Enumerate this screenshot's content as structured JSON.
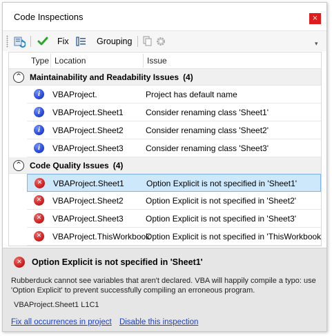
{
  "window": {
    "title": "Code Inspections",
    "close_glyph": "×"
  },
  "toolbar": {
    "fix_label": "Fix",
    "grouping_label": "Grouping",
    "overflow_glyph": "▾"
  },
  "grid": {
    "columns": [
      "Type",
      "Location",
      "Issue"
    ],
    "groups": [
      {
        "title": "Maintainability and Readability Issues",
        "count": "(4)",
        "toggle_glyph": "^",
        "rows": [
          {
            "icon": "info-icon",
            "location": "VBAProject.",
            "issue": "Project has default name"
          },
          {
            "icon": "info-icon",
            "location": "VBAProject.Sheet1",
            "issue": "Consider renaming class 'Sheet1'"
          },
          {
            "icon": "info-icon",
            "location": "VBAProject.Sheet2",
            "issue": "Consider renaming class 'Sheet2'"
          },
          {
            "icon": "info-icon",
            "location": "VBAProject.Sheet3",
            "issue": "Consider renaming class 'Sheet3'"
          }
        ]
      },
      {
        "title": "Code Quality Issues",
        "count": "(4)",
        "toggle_glyph": "^",
        "rows": [
          {
            "icon": "error-icon",
            "location": "VBAProject.Sheet1",
            "issue": "Option Explicit is not specified in 'Sheet1'",
            "selected": true
          },
          {
            "icon": "error-icon",
            "location": "VBAProject.Sheet2",
            "issue": "Option Explicit is not specified in 'Sheet2'"
          },
          {
            "icon": "error-icon",
            "location": "VBAProject.Sheet3",
            "issue": "Option Explicit is not specified in 'Sheet3'"
          },
          {
            "icon": "error-icon",
            "location": "VBAProject.ThisWorkbook",
            "issue": "Option Explicit is not specified in 'ThisWorkbook'"
          }
        ]
      }
    ]
  },
  "details": {
    "title": "Option Explicit is not specified in 'Sheet1'",
    "description": "Rubberduck cannot see variables that aren't declared. VBA will happily compile a typo: use 'Option Explicit' to prevent successfully compiling an erroneous program.",
    "location": "VBAProject.Sheet1 L1C1",
    "fix_all_link": "Fix all occurrences in project",
    "disable_link": "Disable this inspection"
  },
  "colors": {
    "selection": "#cde8fb",
    "link": "#1a3fcc",
    "close": "#e21c1c"
  }
}
